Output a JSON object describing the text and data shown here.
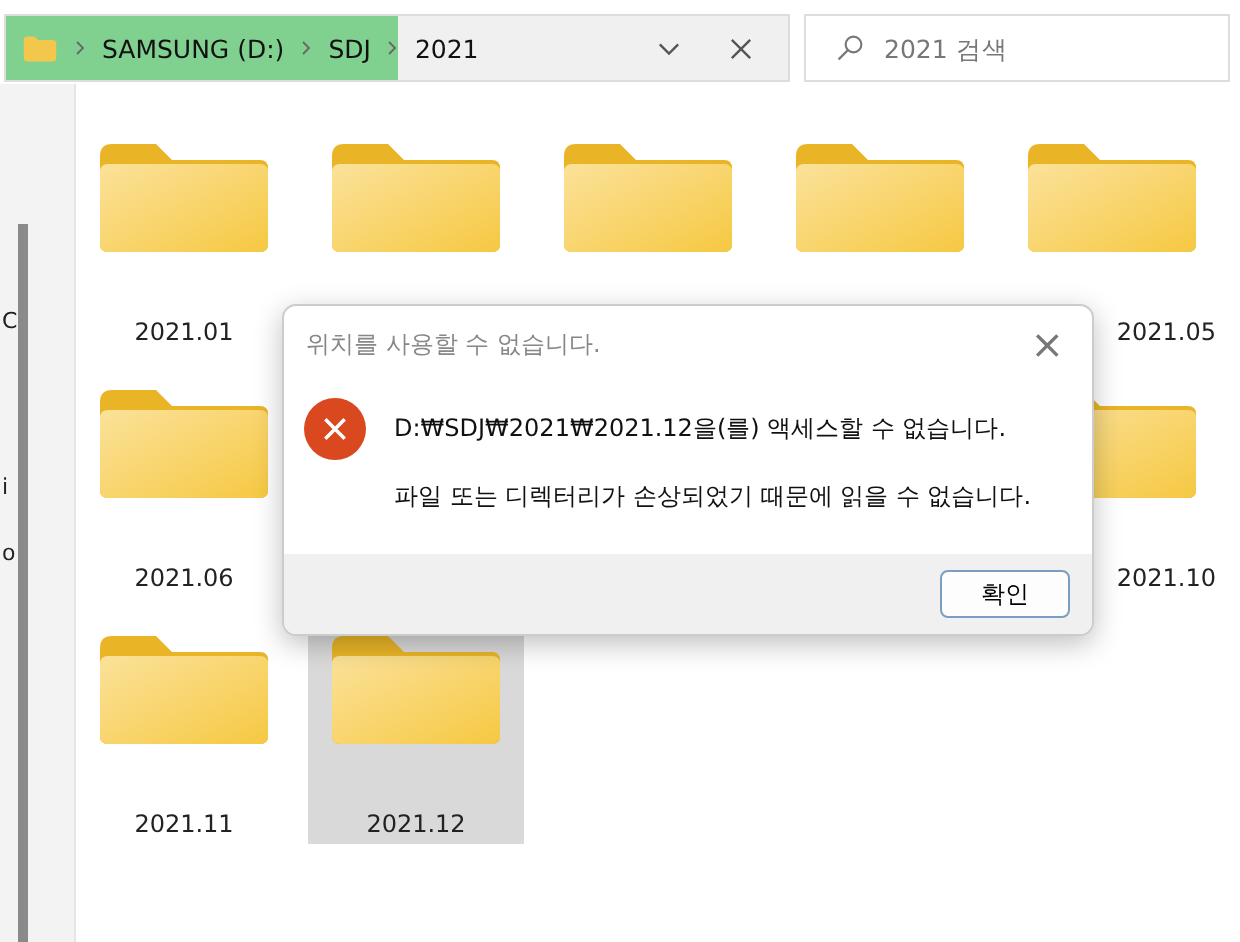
{
  "address_bar": {
    "segments": [
      "SAMSUNG (D:)",
      "SDJ",
      "2021"
    ],
    "highlighted": true
  },
  "search": {
    "placeholder": "2021 검색"
  },
  "sidebar": {
    "items": [
      "C",
      "i",
      "o"
    ]
  },
  "folders": [
    {
      "kind": "folder",
      "label": "2021.01",
      "selected": false
    },
    {
      "kind": "folder",
      "selected": false
    },
    {
      "kind": "folder",
      "selected": false
    },
    {
      "kind": "folder",
      "selected": false
    },
    {
      "kind": "folder",
      "label": "2021.05",
      "selected": false
    },
    {
      "kind": "folder",
      "label": "2021.06",
      "selected": false
    },
    {
      "kind": "hidden"
    },
    {
      "kind": "hidden"
    },
    {
      "kind": "hidden"
    },
    {
      "kind": "folder",
      "label": "2021.10",
      "selected": false
    },
    {
      "kind": "folder",
      "label": "2021.11",
      "selected": false
    },
    {
      "kind": "folder",
      "label": "2021.12",
      "selected": true
    }
  ],
  "dialog": {
    "title": "위치를 사용할 수 없습니다.",
    "close": "×",
    "message": "D:₩SDJ₩2021₩2021.12을(를) 액세스할 수 없습니다.",
    "detail": "파일 또는 디렉터리가 손상되었기 때문에 읽을 수 없습니다.",
    "button": "확인"
  }
}
